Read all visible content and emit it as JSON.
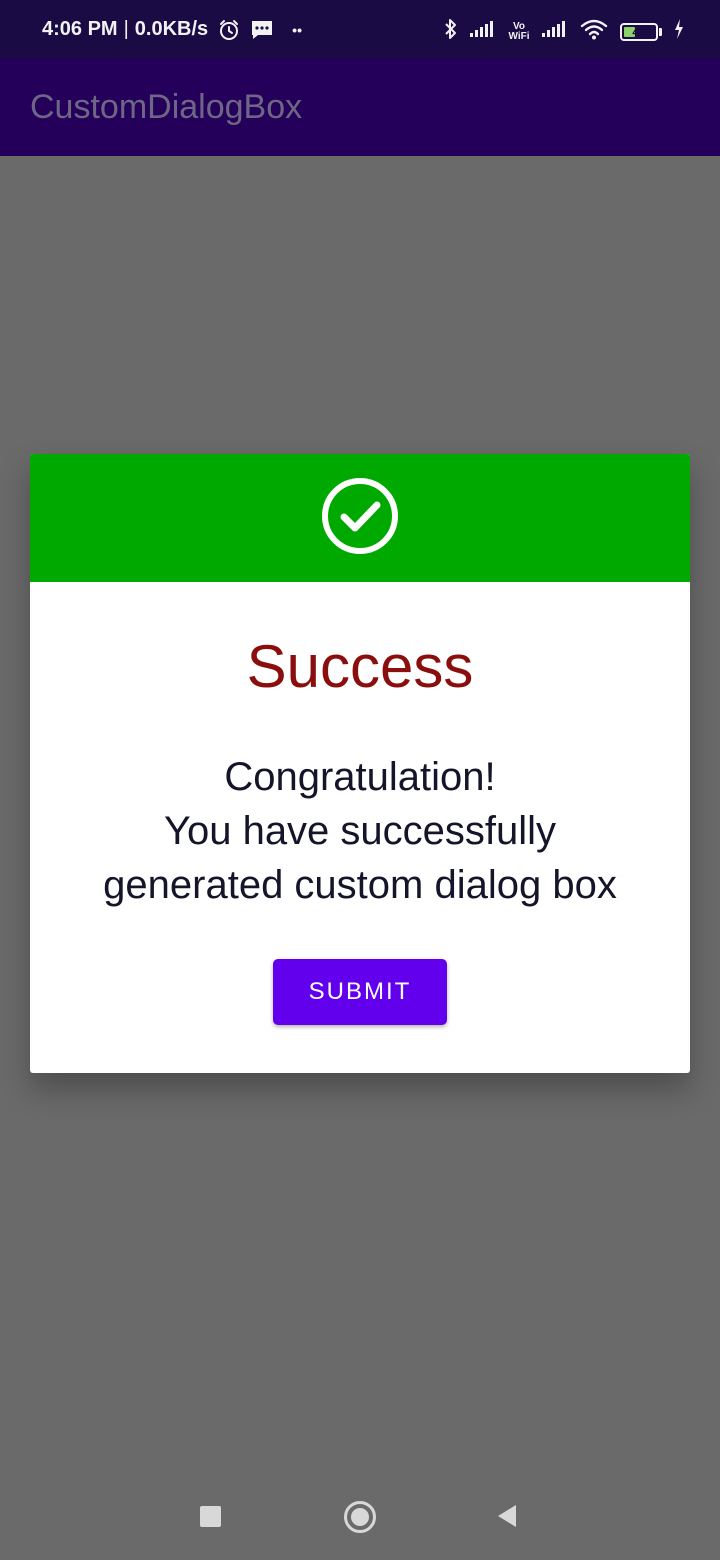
{
  "status_bar": {
    "time": "4:06 PM",
    "separator": "|",
    "network_speed": "0.0KB/s",
    "dots": "••",
    "vowifi_label": "Vo WiFi",
    "battery_level": "44",
    "icons": [
      "alarm-icon",
      "message-icon",
      "bluetooth-icon",
      "signal-icon",
      "vowifi-icon",
      "signal-icon",
      "wifi-icon",
      "battery-icon",
      "charging-icon"
    ]
  },
  "app_bar": {
    "title": "CustomDialogBox"
  },
  "dialog": {
    "header_icon": "check-circle-icon",
    "title": "Success",
    "message_lines": [
      "Congratulation!",
      "You have successfully",
      "generated custom dialog box"
    ],
    "submit_label": "SUBMIT"
  },
  "nav_bar": {
    "icons": [
      "recents-square-icon",
      "home-circle-icon",
      "back-triangle-icon"
    ]
  },
  "colors": {
    "status_bar": "#1a0b45",
    "app_bar": "#24005a",
    "scrim_background": "#6a6a6a",
    "dialog_header": "#00a900",
    "title_text": "#8b0e0e",
    "message_text": "#15152a",
    "submit_button": "#6200ee"
  }
}
